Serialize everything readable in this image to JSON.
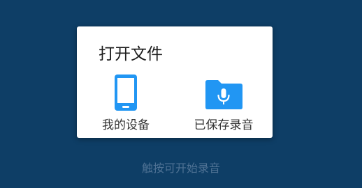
{
  "dialog": {
    "title": "打开文件",
    "options": [
      {
        "label": "我的设备",
        "icon": "phone-icon"
      },
      {
        "label": "已保存录音",
        "icon": "folder-mic-icon"
      }
    ]
  },
  "hint": "触按可开始录音",
  "colors": {
    "background": "#0e3e66",
    "accent": "#2196f3",
    "hint_text": "#4f7294"
  }
}
